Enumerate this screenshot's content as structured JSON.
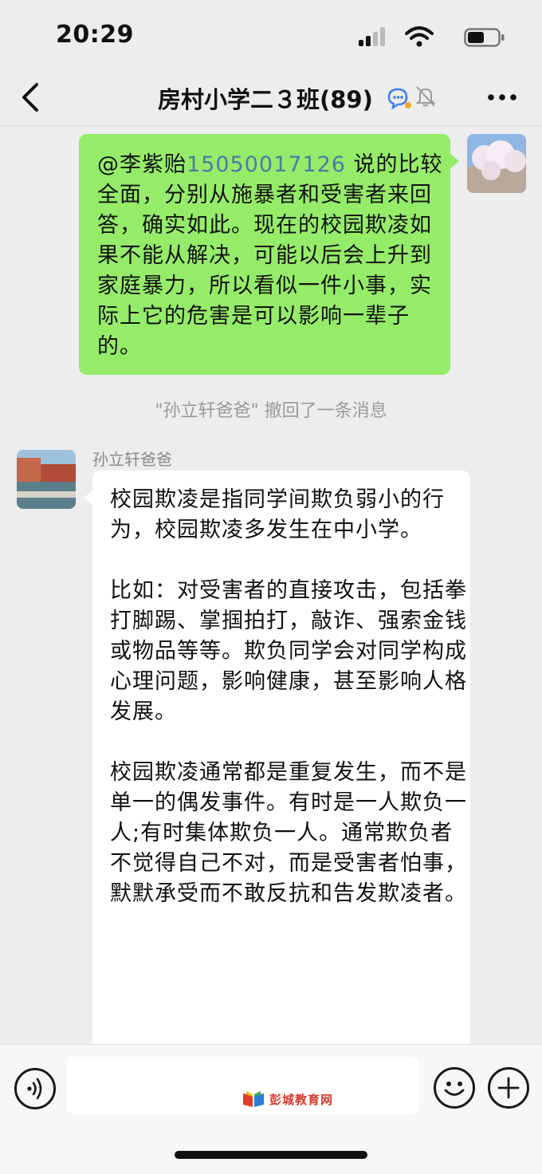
{
  "status_bar": {
    "time": "20:29",
    "signal_icon": "cellular-signal-icon",
    "wifi_icon": "wifi-icon",
    "battery_icon": "battery-icon"
  },
  "header": {
    "back_icon": "chevron-left-icon",
    "title": "房村小学二３班(89)",
    "group_icon": "group-chat-icon",
    "mute_icon": "bell-muted-icon",
    "more_icon": "ellipsis-icon"
  },
  "messages": {
    "sent": {
      "mention_name": "@李紫贻",
      "mention_number": "15050017126",
      "text": " 说的比较全面，分别从施暴者和受害者来回答，确实如此。现在的校园欺凌如果不能从解决，可能以后会上升到家庭暴力，所以看似一件小事，实际上它的危害是可以影响一辈子的。"
    },
    "recall_notice": "\"孙立轩爸爸\" 撤回了一条消息",
    "received": {
      "sender": "孙立轩爸爸",
      "paragraphs": [
        "校园欺凌是指同学间欺负弱小的行为，校园欺凌多发生在中小学。",
        "比如：对受害者的直接攻击，包括拳打脚踢、掌掴拍打，敲诈、强索金钱或物品等等。欺负同学会对同学构成心理问题，影响健康，甚至影响人格发展。",
        "校园欺凌通常都是重复发生，而不是单一的偶发事件。有时是一人欺负一人;有时集体欺负一人。通常欺负者不觉得自己不对，而是受害者怕事，默默承受而不敢反抗和告发欺凌者。"
      ]
    }
  },
  "input_bar": {
    "voice_icon": "voice-icon",
    "watermark": "彭城教育网",
    "emoji_icon": "emoji-icon",
    "plus_icon": "plus-icon"
  },
  "colors": {
    "sent_bubble": "#95ec69",
    "received_bubble": "#ffffff",
    "background": "#ededed",
    "mention": "#5178a8"
  }
}
